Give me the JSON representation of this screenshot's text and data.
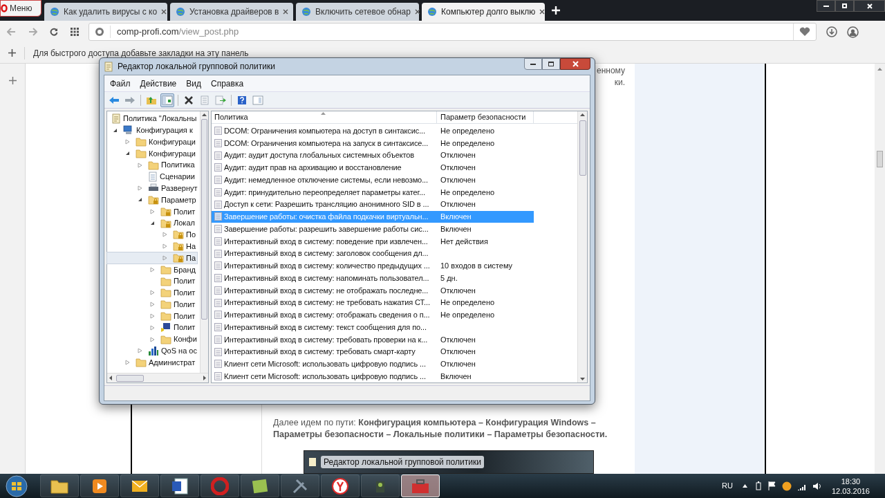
{
  "browser": {
    "menu_button": "Меню",
    "tabs": [
      {
        "title": "Как удалить вирусы с ко",
        "selected": false
      },
      {
        "title": "Установка драйверов в",
        "selected": false
      },
      {
        "title": "Включить сетевое обнар",
        "selected": false
      },
      {
        "title": "Компьютер долго выклю",
        "selected": true
      }
    ],
    "address": {
      "host": "comp-profi.com",
      "path": "/view_post.php"
    },
    "bookmarks_hint": "Для быстрого доступа добавьте закладки на эту панель"
  },
  "page": {
    "fragments": [
      "енному",
      "ки."
    ],
    "path_paragraph": "Далее идем по пути: **Конфигурация компьютера – Конфигурация Windows – Параметры безопасности – Локальные политики – Параметры безопасности.**",
    "embedded_window_title": "Редактор локальной групповой политики"
  },
  "dialog": {
    "title": "Редактор локальной групповой политики",
    "menu": [
      "Файл",
      "Действие",
      "Вид",
      "Справка"
    ],
    "toolbar": [
      {
        "kind": "back",
        "pressed": false
      },
      {
        "kind": "forward",
        "pressed": false
      },
      {
        "kind": "up",
        "pressed": false
      },
      {
        "kind": "tree",
        "pressed": true
      },
      {
        "kind": "delete",
        "pressed": false
      },
      {
        "kind": "properties",
        "pressed": false
      },
      {
        "kind": "export",
        "pressed": false
      },
      {
        "kind": "help",
        "pressed": false
      },
      {
        "kind": "view",
        "pressed": false
      }
    ],
    "tree": [
      {
        "label": "Политика \"Локальны",
        "kind": "scroll",
        "selected": false,
        "children": [
          {
            "label": "Конфигурация к",
            "kind": "computer",
            "expanded": true,
            "selected": false,
            "children": [
              {
                "label": "Конфигураци",
                "kind": "folder",
                "expanded": false,
                "selected": false
              },
              {
                "label": "Конфигураци",
                "kind": "folder",
                "expanded": true,
                "selected": false,
                "children": [
                  {
                    "label": "Политика",
                    "kind": "folder",
                    "expanded": false,
                    "selected": false
                  },
                  {
                    "label": "Сценарии",
                    "kind": "script",
                    "selected": false
                  },
                  {
                    "label": "Развернут",
                    "kind": "printer",
                    "expanded": false,
                    "selected": false
                  },
                  {
                    "label": "Параметр",
                    "kind": "secure",
                    "expanded": true,
                    "selected": false,
                    "children": [
                      {
                        "label": "Полит",
                        "kind": "secure",
                        "expanded": false,
                        "selected": false
                      },
                      {
                        "label": "Локал",
                        "kind": "secure",
                        "expanded": true,
                        "selected": false,
                        "children": [
                          {
                            "label": "По",
                            "kind": "secure",
                            "expanded": false,
                            "selected": false
                          },
                          {
                            "label": "На",
                            "kind": "secure",
                            "expanded": false,
                            "selected": false
                          },
                          {
                            "label": "Па",
                            "kind": "secure",
                            "expanded": false,
                            "selected": true
                          }
                        ]
                      },
                      {
                        "label": "Бранд",
                        "kind": "folder",
                        "expanded": false,
                        "selected": false
                      },
                      {
                        "label": "Полит",
                        "kind": "folder",
                        "selected": false
                      },
                      {
                        "label": "Полит",
                        "kind": "folder",
                        "expanded": false,
                        "selected": false
                      },
                      {
                        "label": "Полит",
                        "kind": "folder",
                        "expanded": false,
                        "selected": false
                      },
                      {
                        "label": "Полит",
                        "kind": "folder",
                        "expanded": false,
                        "selected": false
                      },
                      {
                        "label": "Полит",
                        "kind": "shield",
                        "expanded": false,
                        "selected": false
                      },
                      {
                        "label": "Конфи",
                        "kind": "folder",
                        "expanded": false,
                        "selected": false
                      }
                    ]
                  },
                  {
                    "label": "QoS на ос",
                    "kind": "chart",
                    "expanded": false,
                    "selected": false
                  }
                ]
              },
              {
                "label": "Администрат",
                "kind": "folder",
                "expanded": false,
                "selected": false
              }
            ]
          }
        ]
      }
    ],
    "columns": [
      "Политика",
      "Параметр безопасности"
    ],
    "rows": [
      {
        "policy": "DCOM: Ограничения компьютера на доступ в синтаксис...",
        "value": "Не определено",
        "selected": false
      },
      {
        "policy": "DCOM: Ограничения компьютера на запуск в синтаксисе...",
        "value": "Не определено",
        "selected": false
      },
      {
        "policy": "Аудит: аудит доступа глобальных системных объектов",
        "value": "Отключен",
        "selected": false
      },
      {
        "policy": "Аудит: аудит прав на архивацию и восстановление",
        "value": "Отключен",
        "selected": false
      },
      {
        "policy": "Аудит: немедленное отключение системы, если невозмо...",
        "value": "Отключен",
        "selected": false
      },
      {
        "policy": "Аудит: принудительно переопределяет параметры катег...",
        "value": "Не определено",
        "selected": false
      },
      {
        "policy": "Доступ к сети: Разрешить трансляцию анонимного SID в ...",
        "value": "Отключен",
        "selected": false
      },
      {
        "policy": "Завершение работы: очистка файла подкачки виртуальн...",
        "value": "Включен",
        "selected": true
      },
      {
        "policy": "Завершение работы: разрешить завершение работы сис...",
        "value": "Включен",
        "selected": false
      },
      {
        "policy": "Интерактивный вход в систему:  поведение при извлечен...",
        "value": "Нет действия",
        "selected": false
      },
      {
        "policy": "Интерактивный вход в систему: заголовок сообщения дл...",
        "selected": false
      },
      {
        "policy": "Интерактивный вход в систему: количество предыдущих ...",
        "value": "10 входов в систему",
        "selected": false
      },
      {
        "policy": "Интерактивный вход в систему: напоминать пользовател...",
        "value": "5 дн.",
        "selected": false
      },
      {
        "policy": "Интерактивный вход в систему: не отображать последне...",
        "value": "Отключен",
        "selected": false
      },
      {
        "policy": "Интерактивный вход в систему: не требовать нажатия СТ...",
        "value": "Не определено",
        "selected": false
      },
      {
        "policy": "Интерактивный вход в систему: отображать сведения о п...",
        "value": "Не определено",
        "selected": false
      },
      {
        "policy": "Интерактивный вход в систему: текст сообщения для по...",
        "selected": false
      },
      {
        "policy": "Интерактивный вход в систему: требовать проверки на к...",
        "value": "Отключен",
        "selected": false
      },
      {
        "policy": "Интерактивный вход в систему: требовать смарт-карту",
        "value": "Отключен",
        "selected": false
      },
      {
        "policy": "Клиент сети Microsoft: использовать цифровую подпись ...",
        "value": "Отключен",
        "selected": false
      },
      {
        "policy": "Клиент сети Microsoft: использовать цифровую подпись ...",
        "value": "Включен",
        "selected": false
      }
    ]
  },
  "taskbar": {
    "apps": [
      {
        "kind": "explorer",
        "selected": false
      },
      {
        "kind": "media",
        "selected": false
      },
      {
        "kind": "mail",
        "selected": false
      },
      {
        "kind": "word",
        "selected": false
      },
      {
        "kind": "opera",
        "selected": false
      },
      {
        "kind": "notes",
        "selected": false
      },
      {
        "kind": "tool",
        "selected": false
      },
      {
        "kind": "yandex",
        "selected": false
      },
      {
        "kind": "camera",
        "selected": false
      },
      {
        "kind": "toolbox",
        "selected": true
      }
    ],
    "language": "RU",
    "time": "18:30",
    "date": "12.03.2016"
  }
}
